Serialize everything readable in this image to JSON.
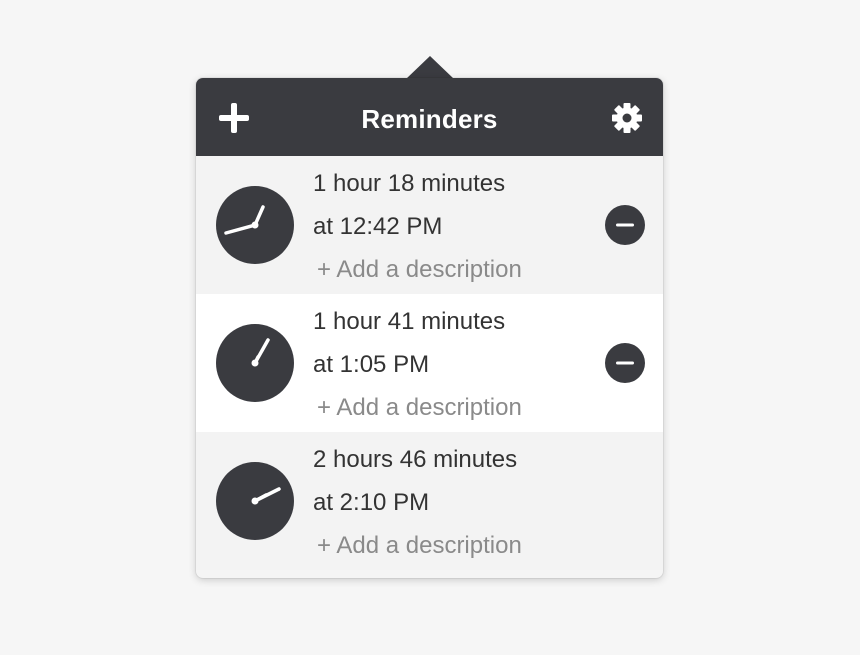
{
  "header": {
    "title": "Reminders",
    "add_icon": "plus-icon",
    "settings_icon": "gear-icon"
  },
  "colors": {
    "header_bg": "#3a3b40",
    "clock_face": "#3a3b40",
    "row_alt": "#f3f3f3",
    "row_plain": "#ffffff",
    "muted_text": "#8a8a8a"
  },
  "reminders": [
    {
      "duration": "1 hour 18 minutes",
      "time": "at 12:42 PM",
      "description_placeholder": "+ Add a description",
      "removable": true
    },
    {
      "duration": "1 hour 41 minutes",
      "time": "at 1:05 PM",
      "description_placeholder": "+ Add a description",
      "removable": true
    },
    {
      "duration": "2 hours 46 minutes",
      "time": "at 2:10 PM",
      "description_placeholder": "+ Add a description",
      "removable": false
    }
  ]
}
